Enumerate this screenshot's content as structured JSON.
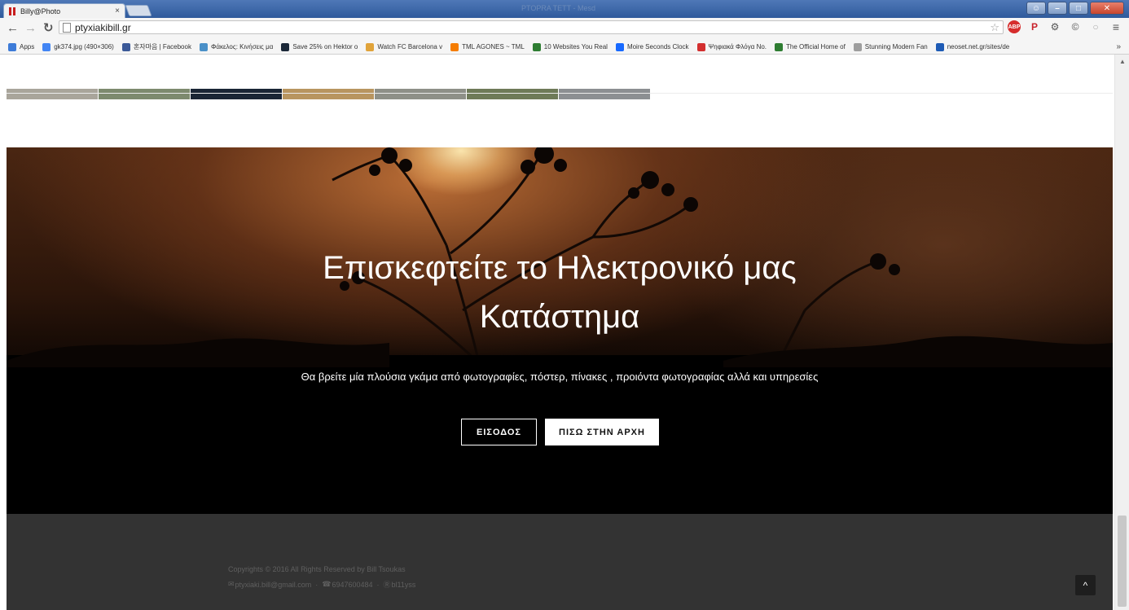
{
  "browser": {
    "tab_title": "Billy@Photo",
    "tab_close": "×",
    "window_title": "PTOPRA TETT - Mesd",
    "url": "ptyxiakibill.gr",
    "bookmarks": [
      {
        "label": "Apps",
        "color": "#3d7bd8"
      },
      {
        "label": "gk374.jpg (490×306)",
        "color": "#4285f4"
      },
      {
        "label": "혼자마음 | Facebook",
        "color": "#3b5998"
      },
      {
        "label": "Φάκελος: Κινήσεις μα",
        "color": "#4a90c8"
      },
      {
        "label": "Save 25% on Hektor o",
        "color": "#1b2838"
      },
      {
        "label": "Watch FC Barcelona v",
        "color": "#e0a33a"
      },
      {
        "label": "TML AGONES ~ TML",
        "color": "#f57c00"
      },
      {
        "label": "10 Websites You Real",
        "color": "#2e7d32"
      },
      {
        "label": "Moire Seconds Clock",
        "color": "#1769ff"
      },
      {
        "label": "Ψηφιακά Φλόγα Νο.",
        "color": "#d32f2f"
      },
      {
        "label": "The Official Home of",
        "color": "#2e7d32"
      },
      {
        "label": "Stunning Modern Fan",
        "color": "#9e9e9e"
      },
      {
        "label": "neoset.net.gr/sites/de",
        "color": "#1e5bb5"
      }
    ],
    "bookmarks_more": "»"
  },
  "hero": {
    "title_line1": "Επισκεφτείτε το Ηλεκτρονικό μας",
    "title_line2": "Κατάστημα",
    "subtitle": "Θα βρείτε μία πλούσια γκάμα από φωτογραφίες, πόστερ, πίνακες , προιόντα φωτογραφίας αλλά και υπηρεσίες",
    "btn_enter": "ΕΙΣΟΔΟΣ",
    "btn_top": "ΠΙΣΩ ΣΤΗΝ ΑΡΧΗ"
  },
  "footer": {
    "copyright": "Copyrights © 2016 All Rights Reserved by Bill Tsoukas",
    "email": "ptyxiaki.bill@gmail.com",
    "phone": "6947600484",
    "skype": "bl11yss",
    "separator": "·",
    "totop": "^"
  },
  "gallery_colors": [
    "#a9a59b",
    "#7d8a6e",
    "#1a2535",
    "#b89560",
    "#8e9088",
    "#6e7a58",
    "#8c8f92"
  ]
}
